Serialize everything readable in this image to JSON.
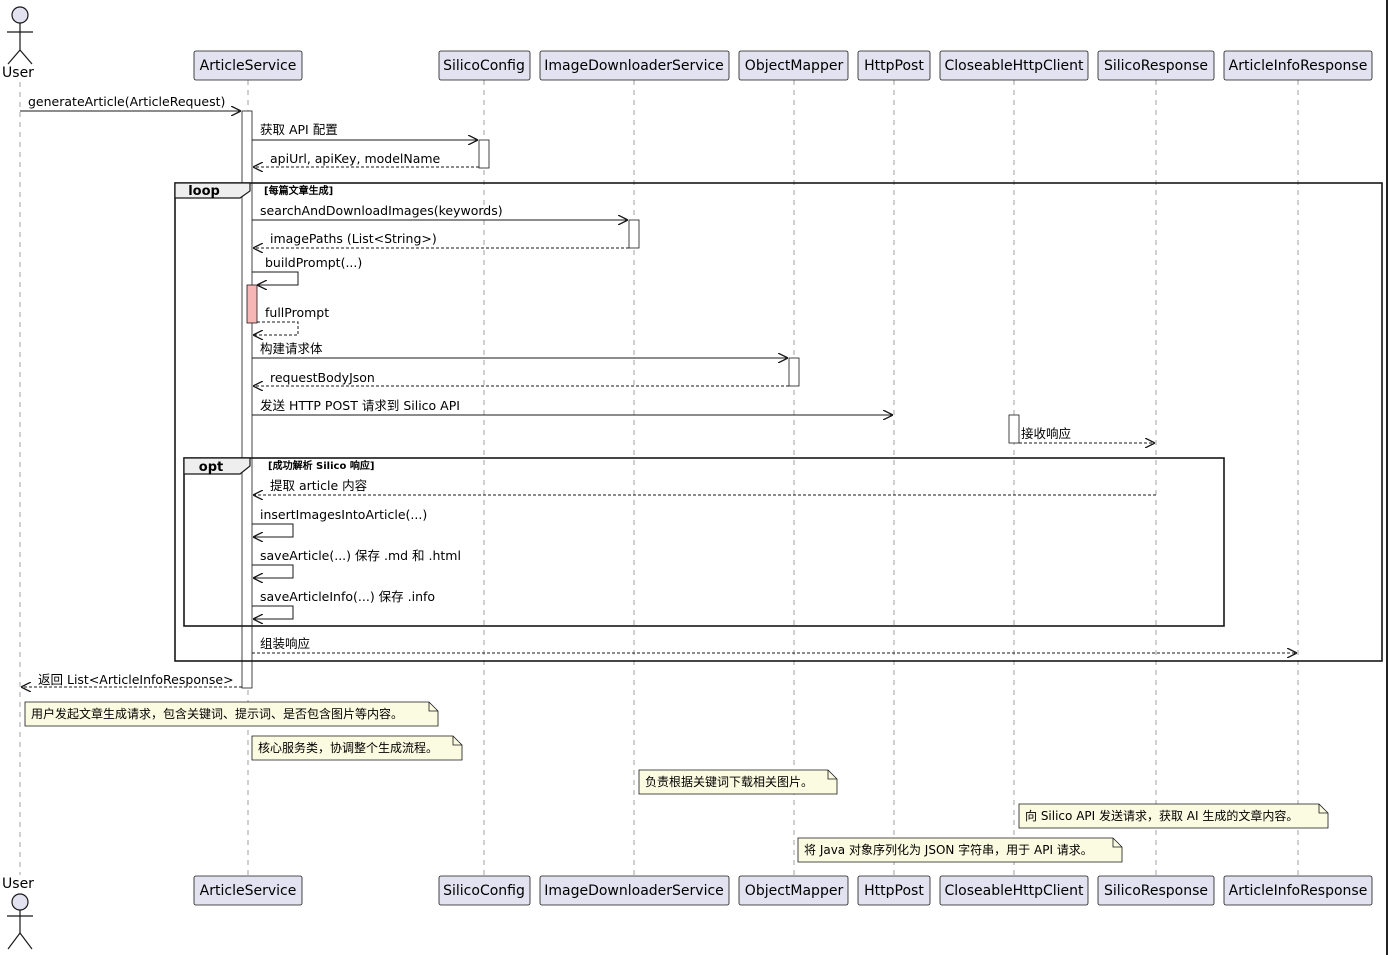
{
  "actor": {
    "name": "User"
  },
  "participants": [
    {
      "id": "article_service",
      "name": "ArticleService"
    },
    {
      "id": "silico_config",
      "name": "SilicoConfig"
    },
    {
      "id": "image_downloader_service",
      "name": "ImageDownloaderService"
    },
    {
      "id": "object_mapper",
      "name": "ObjectMapper"
    },
    {
      "id": "http_post",
      "name": "HttpPost"
    },
    {
      "id": "closeable_http_client",
      "name": "CloseableHttpClient"
    },
    {
      "id": "silico_response",
      "name": "SilicoResponse"
    },
    {
      "id": "article_info_response",
      "name": "ArticleInfoResponse"
    }
  ],
  "messages": {
    "generate_article": "generateArticle(ArticleRequest)",
    "get_api_config": "获取 API 配置",
    "api_config_return": "apiUrl, apiKey, modelName",
    "search_download_images": "searchAndDownloadImages(keywords)",
    "image_paths_return": "imagePaths (List<String>)",
    "build_prompt": "buildPrompt(...)",
    "full_prompt_return": "fullPrompt",
    "build_request_body": "构建请求体",
    "request_body_json_return": "requestBodyJson",
    "send_http_post": "发送 HTTP POST 请求到 Silico API",
    "receive_response": "接收响应",
    "extract_article": "提取 article 内容",
    "insert_images": "insertImagesIntoArticle(...)",
    "save_article": "saveArticle(...) 保存 .md 和 .html",
    "save_article_info": "saveArticleInfo(...) 保存 .info",
    "assemble_response": "组装响应",
    "return_list": "返回 List<ArticleInfoResponse>"
  },
  "frames": {
    "loop": {
      "keyword": "loop",
      "condition": "[每篇文章生成]"
    },
    "opt": {
      "keyword": "opt",
      "condition": "[成功解析 Silico 响应]"
    }
  },
  "notes": {
    "user_note": "用户发起文章生成请求，包含关键词、提示词、是否包含图片等内容。",
    "article_service_note": "核心服务类，协调整个生成流程。",
    "image_downloader_note": "负责根据关键词下载相关图片。",
    "http_client_note": "向 Silico API 发送请求，获取 AI 生成的文章内容。",
    "object_mapper_note": "将 Java 对象序列化为 JSON 字符串，用于 API 请求。"
  },
  "colors": {
    "participant_fill": "#e2e2f0",
    "participant_border": "#181818",
    "note_fill": "#fbfbe1",
    "self_activation_fill": "#f7b6b6",
    "lifeline": "#a0a0a0"
  }
}
